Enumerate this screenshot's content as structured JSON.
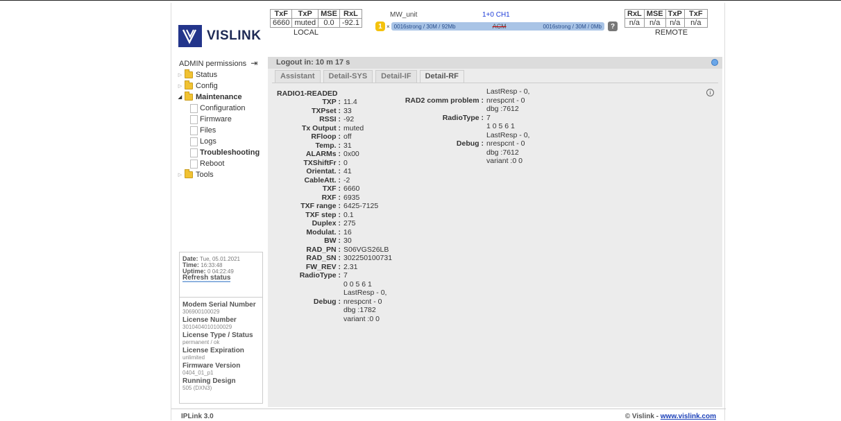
{
  "brand": {
    "name": "VISLINK"
  },
  "local": {
    "label": "LOCAL",
    "headers": [
      "TxF",
      "TxP",
      "MSE",
      "RxL"
    ],
    "values": [
      "6660",
      "muted",
      "0.0",
      "-92.1"
    ]
  },
  "remote": {
    "label": "REMOTE",
    "headers": [
      "RxL",
      "MSE",
      "TxP",
      "TxF"
    ],
    "values": [
      "n/a",
      "n/a",
      "n/a",
      "n/a"
    ]
  },
  "link": {
    "name": "MW_unit",
    "config": "1+0 CH1",
    "count": "1",
    "times": "×",
    "left_rate": "0016strong / 30M / 92Mb",
    "acm": "ACM",
    "right_rate": "0016strong / 30M / 0Mb",
    "help": "?"
  },
  "admin": {
    "label": "ADMIN permissions",
    "logout_icon": "logout-icon"
  },
  "tree": [
    {
      "label": "Status",
      "type": "folder",
      "expanded": false
    },
    {
      "label": "Config",
      "type": "folder",
      "expanded": false
    },
    {
      "label": "Maintenance",
      "type": "folder",
      "expanded": true
    }
  ],
  "maint_children": [
    "Configuration",
    "Firmware",
    "Files",
    "Logs",
    "Troubleshooting",
    "Reboot"
  ],
  "tools": "Tools",
  "status": {
    "date_label": "Date:",
    "date": "Tue, 05.01.2021",
    "time_label": "Time:",
    "time": "16:33:48",
    "uptime_label": "Uptime:",
    "uptime": "0 04:22:49",
    "refresh": "Refresh status"
  },
  "info": [
    {
      "label": "Modem Serial Number",
      "value": "306900100029"
    },
    {
      "label": "License Number",
      "value": "3010404010100029"
    },
    {
      "label": "License Type / Status",
      "value": "permanent / ok"
    },
    {
      "label": "License Expiration",
      "value": "unlimited"
    },
    {
      "label": "Firmware Version",
      "value": "0404_01_p1"
    },
    {
      "label": "Running Design",
      "value": "505 (DXN3)"
    }
  ],
  "logout": "Logout in: 10 m 17 s",
  "tabs": [
    "Assistant",
    "Detail-SYS",
    "Detail-IF",
    "Detail-RF"
  ],
  "active_tab": "Detail-RF",
  "radio1": {
    "title": "RADIO1-READED",
    "rows": [
      [
        "TXP :",
        "11.4"
      ],
      [
        "TXPset :",
        "33"
      ],
      [
        "RSSI :",
        "-92"
      ],
      [
        "Tx Output :",
        "muted"
      ],
      [
        "RFloop :",
        "off"
      ],
      [
        "Temp. :",
        "31"
      ],
      [
        "ALARMs :",
        "0x00"
      ],
      [
        "TXShiftFr :",
        "0"
      ],
      [
        "Orientat. :",
        "41"
      ],
      [
        "CableAtt. :",
        "-2"
      ],
      [
        "TXF :",
        "6660"
      ],
      [
        "RXF :",
        "6935"
      ],
      [
        "TXF range :",
        "6425-7125"
      ],
      [
        "TXF step :",
        "0.1"
      ],
      [
        "Duplex :",
        "275"
      ],
      [
        "Modulat. :",
        "16"
      ],
      [
        "BW :",
        "30"
      ],
      [
        "RAD_PN :",
        "S06VGS26LB"
      ],
      [
        "RAD_SN :",
        "302250100731"
      ],
      [
        "FW_REV :",
        "2.31"
      ],
      [
        "RadioType :",
        "7"
      ],
      [
        "",
        "0 0 5 6 1"
      ],
      [
        "",
        "LastResp - 0,"
      ],
      [
        "Debug :",
        "nrespcnt - 0"
      ],
      [
        "",
        "dbg :1782"
      ],
      [
        "",
        "variant :0 0"
      ]
    ]
  },
  "radio2": {
    "rows": [
      [
        "",
        "LastResp - 0,"
      ],
      [
        "RAD2 comm problem :",
        "nrespcnt - 0"
      ],
      [
        "",
        "dbg :7612"
      ],
      [
        "RadioType :",
        "7"
      ],
      [
        "",
        "1 0 5 6 1"
      ],
      [
        "",
        "LastResp - 0,"
      ],
      [
        "Debug :",
        "nrespcnt - 0"
      ],
      [
        "",
        "dbg :7612"
      ],
      [
        "",
        "variant :0 0"
      ]
    ]
  },
  "footer": {
    "version": "IPLink 3.0",
    "copyright": "© Vislink - ",
    "site": "www.vislink.com"
  }
}
